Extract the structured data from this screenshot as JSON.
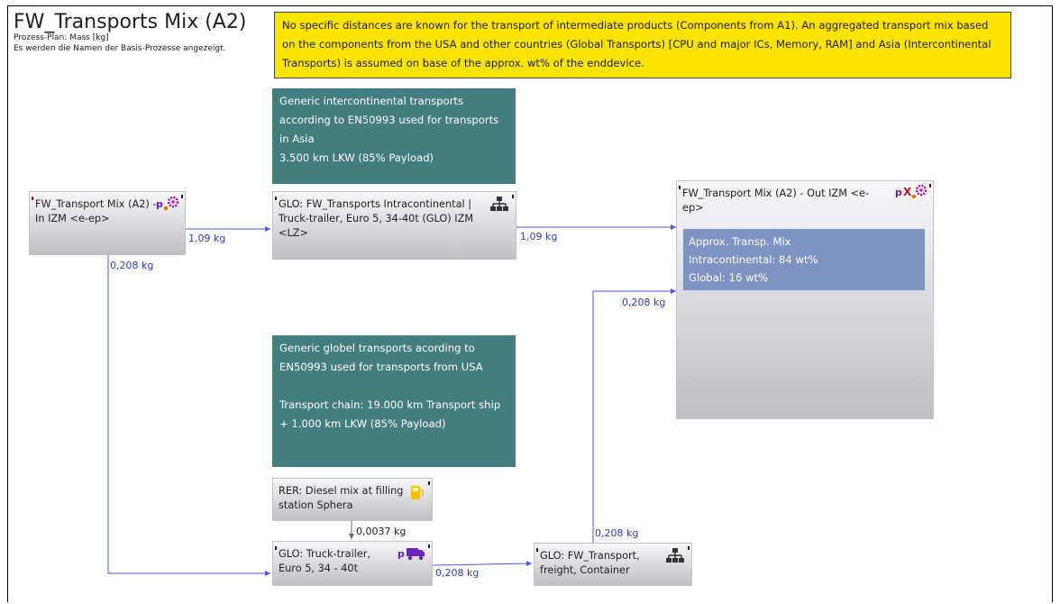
{
  "header": {
    "title": "FW_Transports Mix (A2)",
    "subtitle1": "Prozess-Plan: Mass [kg]",
    "subtitle2": "Es werden die Namen der Basis-Prozesse angezeigt."
  },
  "notes": {
    "yellow": "No specific distances are known for the transport of intermediate products (Components from A1). An aggregated transport mix based on the components from the USA and other countries (Global Transports) [CPU and major ICs, Memory, RAM] and Asia (Intercontinental Transports) is assumed on base of the approx. wt% of the enddevice.",
    "teal1_line1": "Generic intercontinental transports according to EN50993 used for transports in Asia",
    "teal1_line2": "3.500 km LKW (85% Payload)",
    "teal2_line1": "Generic globel transports acording to EN50993 used for transports from USA",
    "teal2_line2": "Transport chain: 19.000 km Transport ship + 1.000 km LKW (85% Payload)"
  },
  "nodes": {
    "in_izm": "FW_Transport Mix (A2) - In IZM <e-ep>",
    "intracontinental": "GLO: FW_Transports Intracontinental | Truck-trailer, Euro 5, 34-40t (GLO) IZM <LZ>",
    "out_izm": "FW_Transport Mix (A2) - Out IZM <e-ep>",
    "diesel": "RER: Diesel mix at filling station Sphera",
    "truck": "GLO: Truck-trailer, Euro 5, 34 - 40t",
    "container": "GLO: FW_Transport, freight, Container"
  },
  "mix_box": {
    "line1": "Approx. Transp. Mix",
    "line2": "Intracontinental: 84 wt%",
    "line3": "Global: 16 wt%"
  },
  "flows": {
    "in_to_intra": "1,09 kg",
    "intra_to_out": "1,09 kg",
    "in_down": "0,208 kg",
    "container_to_out": "0,208 kg",
    "diesel_to_truck": "0,0037 kg",
    "truck_to_container": "0,208 kg",
    "container_up": "0,208 kg"
  },
  "colors": {
    "yellow_note": "#fde300",
    "teal_note": "#427e7d",
    "mix_box": "#7d93c2",
    "flow_line": "#4a5ae0",
    "flow_label": "#2f3fbf"
  },
  "icons": {
    "process_gear": "process-gear-icon",
    "hierarchy": "hierarchy-icon",
    "fuel": "fuel-pump-icon",
    "truck": "truck-icon"
  }
}
